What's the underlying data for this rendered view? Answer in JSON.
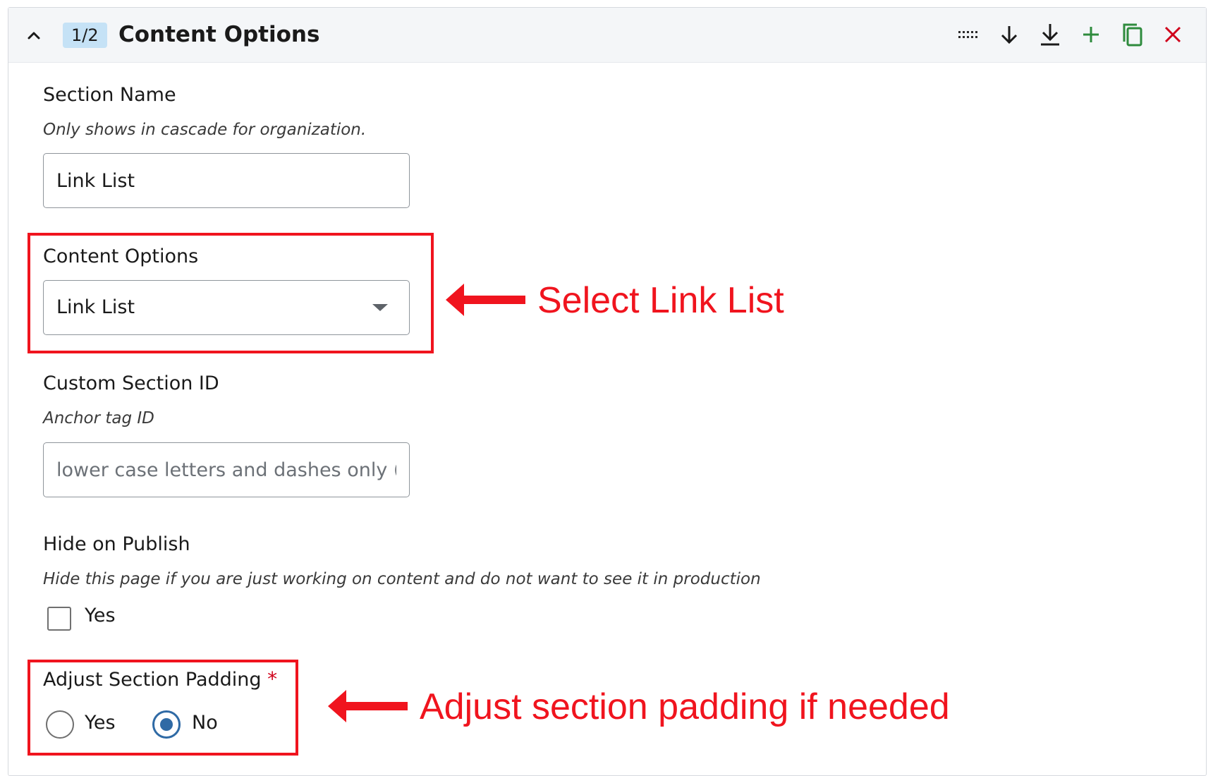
{
  "header": {
    "badge": "1/2",
    "title": "Content Options",
    "tools": [
      {
        "name": "drag-handle-icon"
      },
      {
        "name": "move-down-icon"
      },
      {
        "name": "move-to-bottom-icon"
      },
      {
        "name": "add-icon"
      },
      {
        "name": "duplicate-icon"
      },
      {
        "name": "remove-icon"
      }
    ],
    "colors": {
      "add": "#2e8b3d",
      "duplicate": "#2e8b3d",
      "remove": "#d0021b"
    }
  },
  "section_name": {
    "label": "Section Name",
    "help": "Only shows in cascade for organization.",
    "value": "Link List"
  },
  "content_options": {
    "label": "Content Options",
    "selected": "Link List"
  },
  "custom_section_id": {
    "label": "Custom Section ID",
    "help": "Anchor tag ID",
    "placeholder": "lower case letters and dashes only (ca"
  },
  "hide_on_publish": {
    "label": "Hide on Publish",
    "help": "Hide this page if you are just working on content and do not want to see it in production",
    "option_label": "Yes",
    "checked": false
  },
  "adjust_padding": {
    "label": "Adjust Section Padding",
    "required_mark": "*",
    "options": [
      {
        "label": "Yes",
        "checked": false
      },
      {
        "label": "No",
        "checked": true
      }
    ]
  },
  "annotations": {
    "select_link_list": "Select Link List",
    "adjust_padding": "Adjust section padding if needed",
    "color": "#f0141e"
  }
}
